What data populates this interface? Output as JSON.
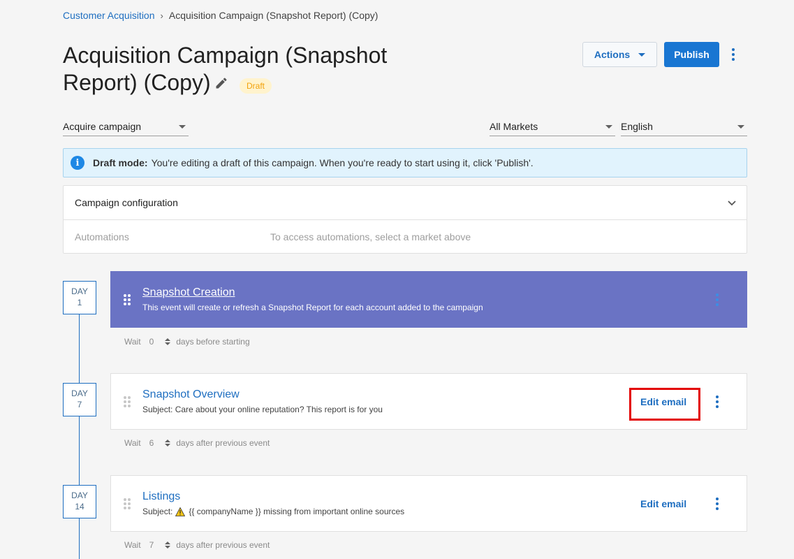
{
  "breadcrumb": {
    "parent": "Customer Acquisition",
    "separator": "›",
    "current": "Acquisition Campaign (Snapshot Report) (Copy)"
  },
  "page": {
    "title": "Acquisition Campaign (Snapshot Report) (Copy)",
    "status_badge": "Draft"
  },
  "header_actions": {
    "actions_label": "Actions",
    "publish_label": "Publish"
  },
  "filters": {
    "campaign_type": "Acquire campaign",
    "market": "All Markets",
    "language": "English"
  },
  "banner": {
    "bold": "Draft mode:",
    "text": "You're editing a draft of this campaign. When you're ready to start using it, click 'Publish'."
  },
  "config": {
    "label": "Campaign configuration",
    "automations_label": "Automations",
    "automations_message": "To access automations, select a market above"
  },
  "events": [
    {
      "day_label": "DAY",
      "day": "1",
      "title": "Snapshot Creation",
      "subtitle": "This event will create or refresh a Snapshot Report for each account added to the campaign",
      "wait_label": "Wait",
      "wait_value": "0",
      "wait_suffix": "days before starting"
    },
    {
      "day_label": "DAY",
      "day": "7",
      "title": "Snapshot Overview",
      "subject_prefix": "Subject:",
      "subject": "Care about your online reputation? This report is for you",
      "edit_label": "Edit email",
      "wait_label": "Wait",
      "wait_value": "6",
      "wait_suffix": "days after previous event"
    },
    {
      "day_label": "DAY",
      "day": "14",
      "title": "Listings",
      "subject_prefix": "Subject:",
      "subject": "{{ companyName }} missing from important online sources",
      "edit_label": "Edit email",
      "wait_label": "Wait",
      "wait_value": "7",
      "wait_suffix": "days after previous event"
    }
  ],
  "colors": {
    "accent": "#1976d2",
    "link": "#1e6ec0",
    "highlight_card": "#6a73c4",
    "draft_badge_bg": "#fff3cd",
    "draft_badge_text": "#f2a20b",
    "banner_bg": "#e1f3fd",
    "annotation_box": "#e30000"
  }
}
